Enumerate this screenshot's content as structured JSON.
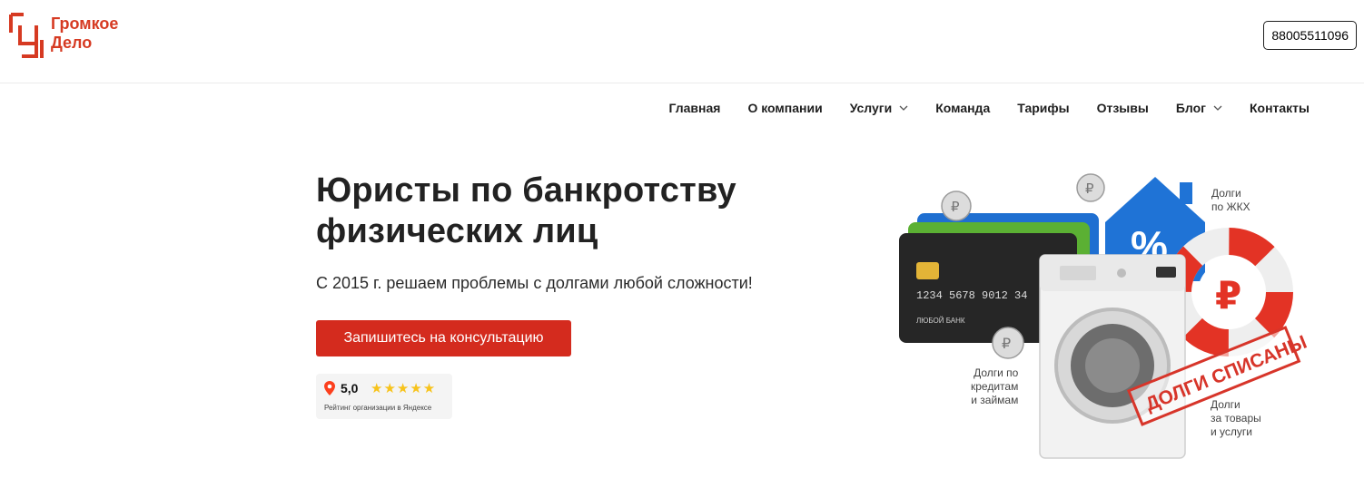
{
  "header": {
    "logo_line1": "Громкое",
    "logo_line2": "Дело",
    "phone": "88005511096"
  },
  "nav": {
    "items": [
      {
        "label": "Главная"
      },
      {
        "label": "О компании"
      },
      {
        "label": "Услуги"
      },
      {
        "label": "Команда"
      },
      {
        "label": "Тарифы"
      },
      {
        "label": "Отзывы"
      },
      {
        "label": "Блог"
      },
      {
        "label": "Контакты"
      }
    ]
  },
  "hero": {
    "title_line1": "Юристы по банкротству",
    "title_line2": "физических лиц",
    "subtitle": "С 2015 г. решаем проблемы с долгами любой сложности!",
    "cta": "Запишитесь на консультацию"
  },
  "rating": {
    "score": "5,0",
    "stars": "★★★★★",
    "caption": "Рейтинг организации в Яндексе"
  },
  "illustration": {
    "card_number": "1234  5678  9012  34",
    "card_holder": "ЛЮБОЙ БАНК",
    "stamp": "ДОЛГИ СПИСАНЫ",
    "label_zhkh_1": "Долги",
    "label_zhkh_2": "по ЖКХ",
    "label_credit_1": "Долги по",
    "label_credit_2": "кредитам",
    "label_credit_3": "и займам",
    "label_goods_1": "Долги",
    "label_goods_2": "за товары",
    "label_goods_3": "и услуги",
    "percent": "%",
    "ruble": "₽"
  },
  "colors": {
    "brand_red": "#d63a22",
    "cta_red": "#d42b1e",
    "house_blue": "#1f73d6",
    "star_yellow": "#f7c31b"
  }
}
